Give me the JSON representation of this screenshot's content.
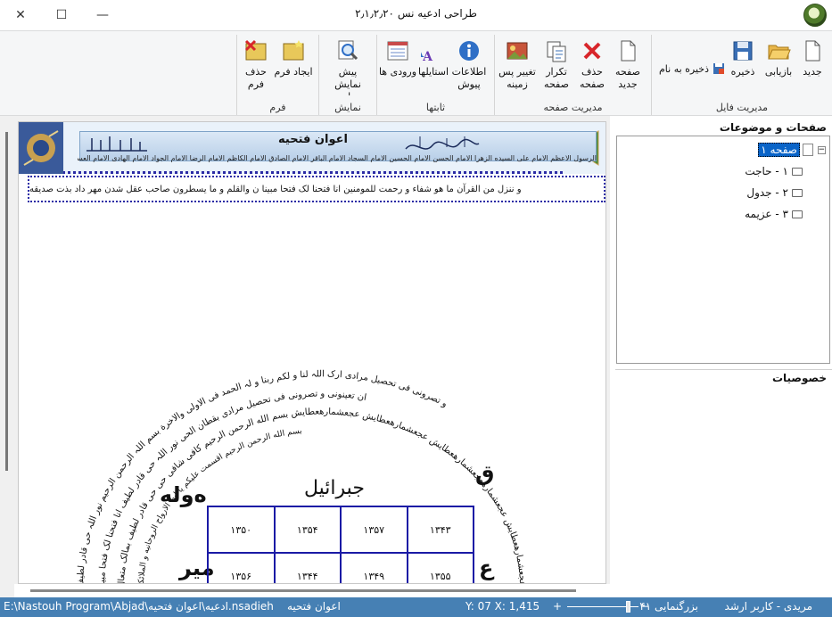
{
  "window": {
    "title": "طراحی ادعیه نس ۲٫۱٫۲٫۲۰"
  },
  "ribbon": {
    "groups": [
      {
        "title": "مدیریت فایل",
        "buttons": [
          "جدید",
          "بازیابی",
          "ذخیره"
        ],
        "wide_button": "ذخیره به نام"
      },
      {
        "title": "مدیریت صفحه",
        "buttons": [
          "صفحه جدید",
          "حذف صفحه",
          "تکرار صفحه",
          "تغییر پس زمینه"
        ]
      },
      {
        "title": "ثابتها",
        "buttons": [
          "اطلاعات پیوش",
          "استایلها",
          "ورودی ها"
        ]
      },
      {
        "title": "نمایش",
        "buttons": [
          "پیش نمایش چاپ"
        ]
      },
      {
        "title": "فرم",
        "buttons": [
          "ایجاد فرم",
          "حذف فرم"
        ]
      }
    ]
  },
  "doc": {
    "header_title": "اعوان فتحیه",
    "header_sub": "الرسول الاعظم الامام علی السیده الزهرا الامام الحسن الامام الحسین الامام السجاد الامام الباقر الامام الصادق الامام الکاظم الامام الرضا الامام الجواد الامام الهادی الامام العسکری الامام المنتظر",
    "verse": "و ننزل من القرآن ما هو شفاء و رحمت للمومنین انا فتحنا لک فتحا مبینا ن والقلم و ما یسطرون صاحب عقل شدن مهر داد بذت صدیقه",
    "arch_outer": "عجعشمارهعطایش عجعشمارهعجعشمارهعطایش عجعشمارهعطایش عجعشمارهعطایش بسم الله الرحمن الرحیم کافی شافی حی حی قادر لطیف بمالک متعال",
    "arch_mid": "و تصرونی فی تحصیل مرادی ارک اللہ لنا و لکم ربنا و لہ الحمد فی الاولی والاخرة بسم اللہ الرحمن الرحیم نور اللہ حی قادر لطیف",
    "arch_mid2": "ان تعینونی و تصرونی فی تحصیل مرادی بقطان الحی نور اللہ حی قادر لطیف انا فتحنا لک فتحا مبینا",
    "arch_inner": "بسم الله الرحمن الرحیم اقسمت علیکم یا ایها الارواح الروحانیه و الملائکه",
    "grid_title": "جبرائیل",
    "grid": [
      [
        "۱۳۵۰",
        "۱۳۵۴",
        "۱۳۵۷",
        "۱۳۴۳"
      ],
      [
        "۱۳۵۶",
        "۱۳۴۴",
        "۱۳۴۹",
        "۱۳۵۵"
      ]
    ],
    "side_left_top": "ه‌وله",
    "side_right_top": "ق",
    "side_left_bottom": "میر",
    "side_right_bottom": "ع"
  },
  "panel": {
    "pages_title": "صفحات و موضوعات",
    "tree_root": "صفحه ۱",
    "tree_items": [
      "۱ - حاجت",
      "۲ - جدول",
      "۳ - عزیمه"
    ],
    "props_title": "خصوصیات"
  },
  "status": {
    "user": "مریدی - کاربر ارشد",
    "zoom": "بزرگنمایی ۴۱",
    "coords": "Y: 07  X: 1,415",
    "filename": "اعوان فتحیه",
    "path": "E:\\Nastouh Program\\Abjad\\ادعیه\\اعوان فتحیه.nsadieh"
  },
  "colors": {
    "accent": "#4680b4",
    "table_border": "#1a1aa5",
    "selection": "#0a64c8"
  }
}
